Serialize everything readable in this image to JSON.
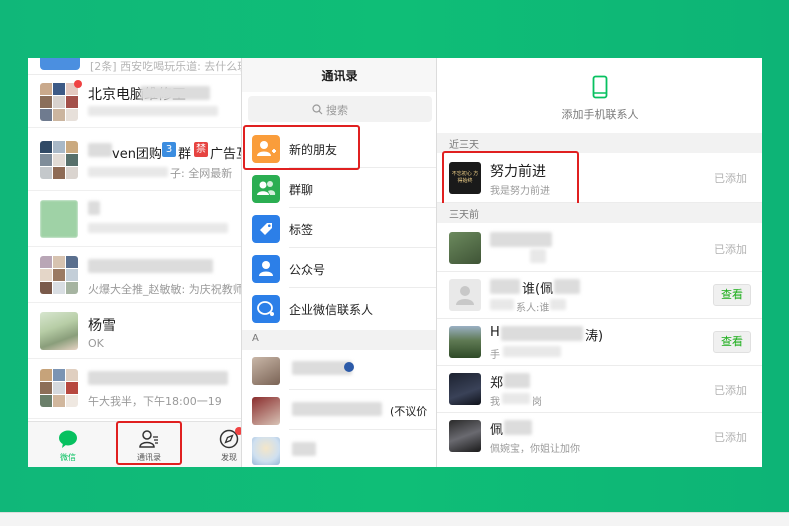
{
  "colors": {
    "background_green": "#10b779",
    "wechat_green": "#07c160",
    "highlight_red": "#e02020",
    "view_button_text": "#1aad19"
  },
  "chats": {
    "top_preview": "[2条] 西安吃喝玩乐道: 去什么玩",
    "items": [
      {
        "name": "北京电脑维修王",
        "preview": "",
        "avatar": "group-mosaic-icon",
        "badge": true
      },
      {
        "name": "ven团购",
        "name_tail": "群",
        "badge3": "3",
        "badge_jin": "禁",
        "name_tail2": "广告互",
        "preview": "子: 全网最新",
        "avatar": "group-mosaic-icon"
      },
      {
        "name": "",
        "preview": "",
        "avatar": "green-group-icon"
      },
      {
        "name": "",
        "preview": "火爆大全推_赵敏敏: 为庆祝教师",
        "avatar": "group-mosaic-icon"
      },
      {
        "name": "杨雪",
        "preview": "OK",
        "avatar": "photo-avatar"
      },
      {
        "name": "",
        "preview": "午大我半，下午18:00一19",
        "avatar": "group-mosaic-icon"
      }
    ],
    "tabs": [
      {
        "label": "微信",
        "icon": "chat-bubble-icon",
        "active": true
      },
      {
        "label": "通讯录",
        "icon": "contacts-icon",
        "active": false
      },
      {
        "label": "发现",
        "icon": "compass-icon",
        "active": false
      }
    ]
  },
  "contacts": {
    "title": "通讯录",
    "search_placeholder": "搜索",
    "items": [
      {
        "label": "新的朋友",
        "icon": "add-friend-icon",
        "color": "#fa9d3b"
      },
      {
        "label": "群聊",
        "icon": "group-chat-icon",
        "color": "#2bae52"
      },
      {
        "label": "标签",
        "icon": "tag-icon",
        "color": "#2c7fe8"
      },
      {
        "label": "公众号",
        "icon": "official-account-icon",
        "color": "#2c7fe8"
      },
      {
        "label": "企业微信联系人",
        "icon": "work-wechat-icon",
        "color": "#2c7fe8"
      }
    ],
    "section_a": "A",
    "a_items": [
      {
        "label": "",
        "avatar": "photo-avatar"
      },
      {
        "label": "(不议价",
        "avatar": "photo-avatar"
      },
      {
        "label": "",
        "avatar": "cartoon-avatar"
      }
    ]
  },
  "new_friends": {
    "add_phone_label": "添加手机联系人",
    "section_recent": "近三天",
    "section_older": "三天前",
    "recent": [
      {
        "name": "努力前进",
        "note": "我是努力前进",
        "status": "已添加",
        "avatar": "black-logo-avatar",
        "avatar_text": "不忘初心 方得始终"
      }
    ],
    "older": [
      {
        "name": "",
        "note": "",
        "status": "已添加",
        "action": "added"
      },
      {
        "name": "谁(佩",
        "note": "系人:谁",
        "status": "查看",
        "action": "view"
      },
      {
        "name": "H",
        "name_tail": "涛)",
        "note": "手",
        "status": "查看",
        "action": "view"
      },
      {
        "name": "郑",
        "note": "我",
        "note_tail": "岗",
        "status": "已添加",
        "action": "added"
      },
      {
        "name": "佩",
        "note": "佩婉宝，你姐让加你",
        "status": "已添加",
        "action": "added"
      }
    ]
  }
}
